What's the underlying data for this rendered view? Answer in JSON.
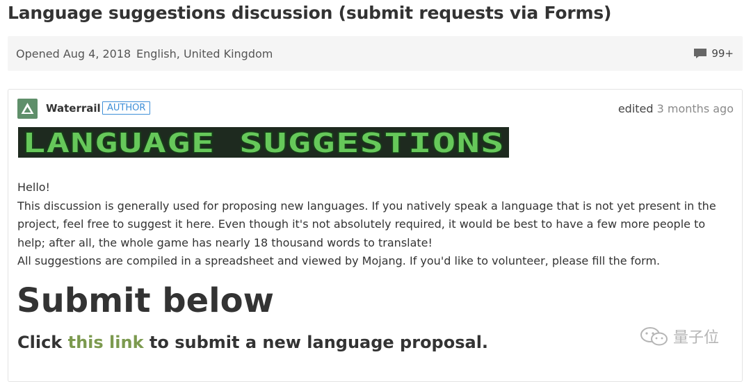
{
  "page": {
    "title": "Language suggestions discussion (submit requests via Forms)"
  },
  "meta": {
    "opened": "Opened Aug 4, 2018",
    "language": "English, United Kingdom",
    "comment_icon": "comment-icon",
    "comment_count": "99+"
  },
  "post": {
    "author": "Waterrail",
    "badge": "AUTHOR",
    "edited_label": "edited",
    "edited_time": "3 months ago",
    "banner_text": "LANGUAGE SUGGESTIONS",
    "paragraphs": [
      "Hello!",
      "This discussion is generally used for proposing new languages. If you natively speak a language that is not yet present in the project, feel free to suggest it here. Even though it's not absolutely required, it would be best to have a few more people to help; after all, the whole game has nearly 18 thousand words to translate!",
      "All suggestions are compiled in a spreadsheet and viewed by Mojang. If you'd like to volunteer, please fill the form."
    ],
    "heading": "Submit below",
    "click_prefix": "Click ",
    "click_link": "this link",
    "click_suffix": " to submit a new language proposal."
  },
  "watermark": {
    "text": "量子位",
    "icon": "wechat-icon"
  },
  "colors": {
    "link": "#7c9a4f",
    "badge": "#3e8fd8",
    "banner_fill": "#66c85a",
    "banner_outline": "#163d18"
  }
}
